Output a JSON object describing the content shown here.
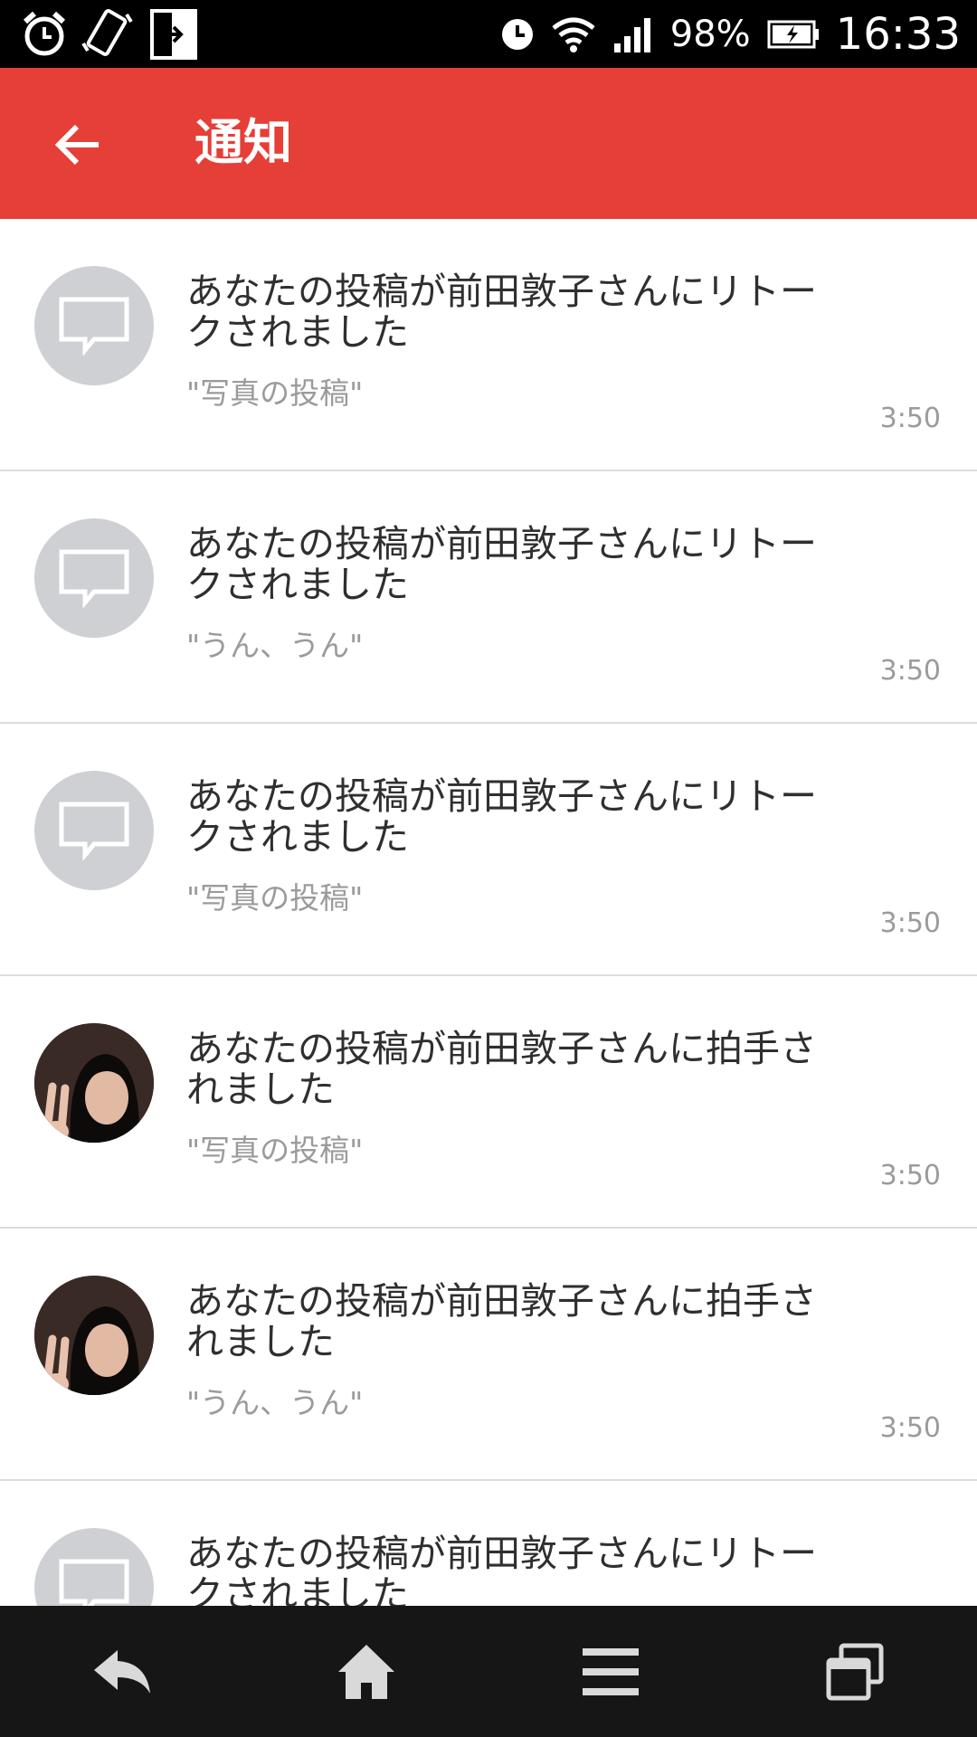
{
  "status_bar": {
    "battery_percent": "98%",
    "clock": "16:33",
    "left_icons": [
      "alarm-clock-icon",
      "vibrate-icon",
      "screen-mirror-icon"
    ],
    "right_icons": [
      "alarm-icon",
      "wifi-icon",
      "signal-icon",
      "battery-charging-icon"
    ]
  },
  "app_bar": {
    "title": "通知",
    "back_icon": "arrow-left-icon",
    "color": "#e53f37"
  },
  "notifications": [
    {
      "title": "あなたの投稿が前田敦子さんにリトークされました",
      "quote": "\"写真の投稿\"",
      "time": "3:50",
      "avatar": "comment-placeholder"
    },
    {
      "title": "あなたの投稿が前田敦子さんにリトークされました",
      "quote": "\"うん、うん\"",
      "time": "3:50",
      "avatar": "comment-placeholder"
    },
    {
      "title": "あなたの投稿が前田敦子さんにリトークされました",
      "quote": "\"写真の投稿\"",
      "time": "3:50",
      "avatar": "comment-placeholder"
    },
    {
      "title": "あなたの投稿が前田敦子さんに拍手されました",
      "quote": "\"写真の投稿\"",
      "time": "3:50",
      "avatar": "user-photo"
    },
    {
      "title": "あなたの投稿が前田敦子さんに拍手されました",
      "quote": "\"うん、うん\"",
      "time": "3:50",
      "avatar": "user-photo"
    },
    {
      "title": "あなたの投稿が前田敦子さんにリトークされました",
      "quote": "",
      "time": "",
      "avatar": "comment-placeholder"
    }
  ],
  "nav_bar": {
    "icons": [
      "back-icon",
      "home-icon",
      "menu-icon",
      "recent-apps-icon"
    ]
  }
}
